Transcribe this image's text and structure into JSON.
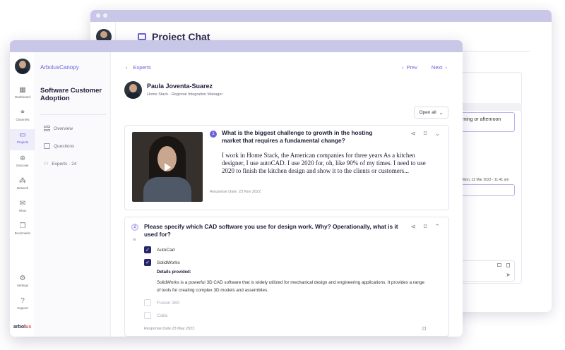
{
  "back_window": {
    "title": "Project Chat",
    "chat_snippet": "rning or afternoon",
    "chat_time": "Mon, 12 Mar 2023 - 11:41 am"
  },
  "rail": {
    "items": [
      {
        "label": "Dashboard",
        "icon": "grid-icon"
      },
      {
        "label": "Channels",
        "icon": "channels-icon"
      },
      {
        "label": "Projects",
        "icon": "folder-icon",
        "active": true
      },
      {
        "label": "Discover",
        "icon": "discover-icon"
      },
      {
        "label": "Network",
        "icon": "network-icon"
      },
      {
        "label": "Inbox",
        "icon": "mail-icon"
      },
      {
        "label": "Bookmarks",
        "icon": "bookmark-icon"
      },
      {
        "label": "Settings",
        "icon": "gear-icon"
      },
      {
        "label": "Support",
        "icon": "help-icon"
      }
    ],
    "logo": {
      "main": "arbol",
      "accent": "us"
    }
  },
  "project": {
    "brand": "ArbolusCanopy",
    "title": "Software Customer Adoption",
    "nav": {
      "overview": "Overview",
      "questions": "Questions",
      "experts": "Experts · 24"
    }
  },
  "main": {
    "back_label": "Experts",
    "prev_label": "Prev",
    "next_label": "Next",
    "expert": {
      "name": "Paula Joventa-Suarez",
      "role": "Home Stack - Regional Integration Manager"
    },
    "open_all_label": "Open all",
    "questions": [
      {
        "number": "1",
        "text": "What is the biggest challenge to growth in the hosting market that requires a fundamental change?",
        "answer": "I work in Home Stack, the American companies for three years As a kitchen designer, I use autoCAD. I use 2020 for, oh, like 90% of my times. I need to use 2020 to finish the kitchen design and show it to the clients or customers...",
        "response_date": "Response Date: 23 Nov 2022"
      },
      {
        "number": "2",
        "text": "Please specify which CAD software you use for design work. Why? Operationally, what is it used for?",
        "options": [
          {
            "label": "AutoCad",
            "checked": true
          },
          {
            "label": "SolidWorks",
            "checked": true
          },
          {
            "label": "Fusion 360",
            "checked": false
          },
          {
            "label": "Catia",
            "checked": false
          }
        ],
        "details_label": "Details provided:",
        "details_text": "SolidWorks is a powerful 3D CAD software that is widely utilized for mechanical design and engineering applications. It provides a range of tools for creating complex 3D models and assemblies.",
        "response_date": "Response Date 23 May 2023"
      }
    ]
  },
  "colors": {
    "accent": "#6b63d9",
    "titlebar": "#c9c7e8",
    "checkbox_on": "#26246a"
  }
}
